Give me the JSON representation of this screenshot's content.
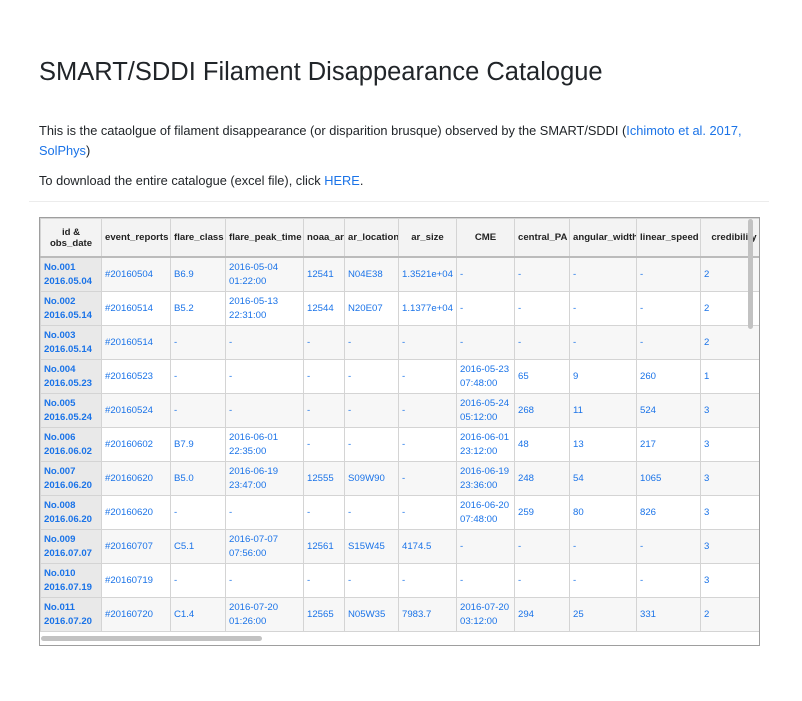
{
  "page": {
    "title": "SMART/SDDI Filament Disappearance Catalogue",
    "intro_text": "This is the cataolgue of filament disappearance (or disparition brusque) observed by the SMART/SDDI (",
    "intro_link": "Ichimoto et al. 2017, SolPhys",
    "intro_end": ")",
    "download_text": "To download the entire catalogue (excel file), click ",
    "download_link": "HERE",
    "download_end": "."
  },
  "table": {
    "headers": [
      "id &\nobs_date",
      "event_reports",
      "flare_class",
      "flare_peak_time",
      "noaa_ar",
      "ar_location",
      "ar_size",
      "CME",
      "central_PA",
      "angular_width",
      "linear_speed",
      "credibility"
    ],
    "rows": [
      [
        "No.001\n2016.05.04",
        "#20160504",
        "B6.9",
        "2016-05-04\n01:22:00",
        "12541",
        "N04E38",
        "1.3521e+04",
        "-",
        "-",
        "-",
        "-",
        "2"
      ],
      [
        "No.002\n2016.05.14",
        "#20160514",
        "B5.2",
        "2016-05-13\n22:31:00",
        "12544",
        "N20E07",
        "1.1377e+04",
        "-",
        "-",
        "-",
        "-",
        "2"
      ],
      [
        "No.003\n2016.05.14",
        "#20160514",
        "-",
        "-",
        "-",
        "-",
        "-",
        "-",
        "-",
        "-",
        "-",
        "2"
      ],
      [
        "No.004\n2016.05.23",
        "#20160523",
        "-",
        "-",
        "-",
        "-",
        "-",
        "2016-05-23\n07:48:00",
        "65",
        "9",
        "260",
        "1"
      ],
      [
        "No.005\n2016.05.24",
        "#20160524",
        "-",
        "-",
        "-",
        "-",
        "-",
        "2016-05-24\n05:12:00",
        "268",
        "11",
        "524",
        "3"
      ],
      [
        "No.006\n2016.06.02",
        "#20160602",
        "B7.9",
        "2016-06-01\n22:35:00",
        "-",
        "-",
        "-",
        "2016-06-01\n23:12:00",
        "48",
        "13",
        "217",
        "3"
      ],
      [
        "No.007\n2016.06.20",
        "#20160620",
        "B5.0",
        "2016-06-19\n23:47:00",
        "12555",
        "S09W90",
        "-",
        "2016-06-19\n23:36:00",
        "248",
        "54",
        "1065",
        "3"
      ],
      [
        "No.008\n2016.06.20",
        "#20160620",
        "-",
        "-",
        "-",
        "-",
        "-",
        "2016-06-20\n07:48:00",
        "259",
        "80",
        "826",
        "3"
      ],
      [
        "No.009\n2016.07.07",
        "#20160707",
        "C5.1",
        "2016-07-07\n07:56:00",
        "12561",
        "S15W45",
        "4174.5",
        "-",
        "-",
        "-",
        "-",
        "3"
      ],
      [
        "No.010\n2016.07.19",
        "#20160719",
        "-",
        "-",
        "-",
        "-",
        "-",
        "-",
        "-",
        "-",
        "-",
        "3"
      ],
      [
        "No.011\n2016.07.20",
        "#20160720",
        "C1.4",
        "2016-07-20\n01:26:00",
        "12565",
        "N05W35",
        "7983.7",
        "2016-07-20\n03:12:00",
        "294",
        "25",
        "331",
        "2"
      ]
    ]
  }
}
